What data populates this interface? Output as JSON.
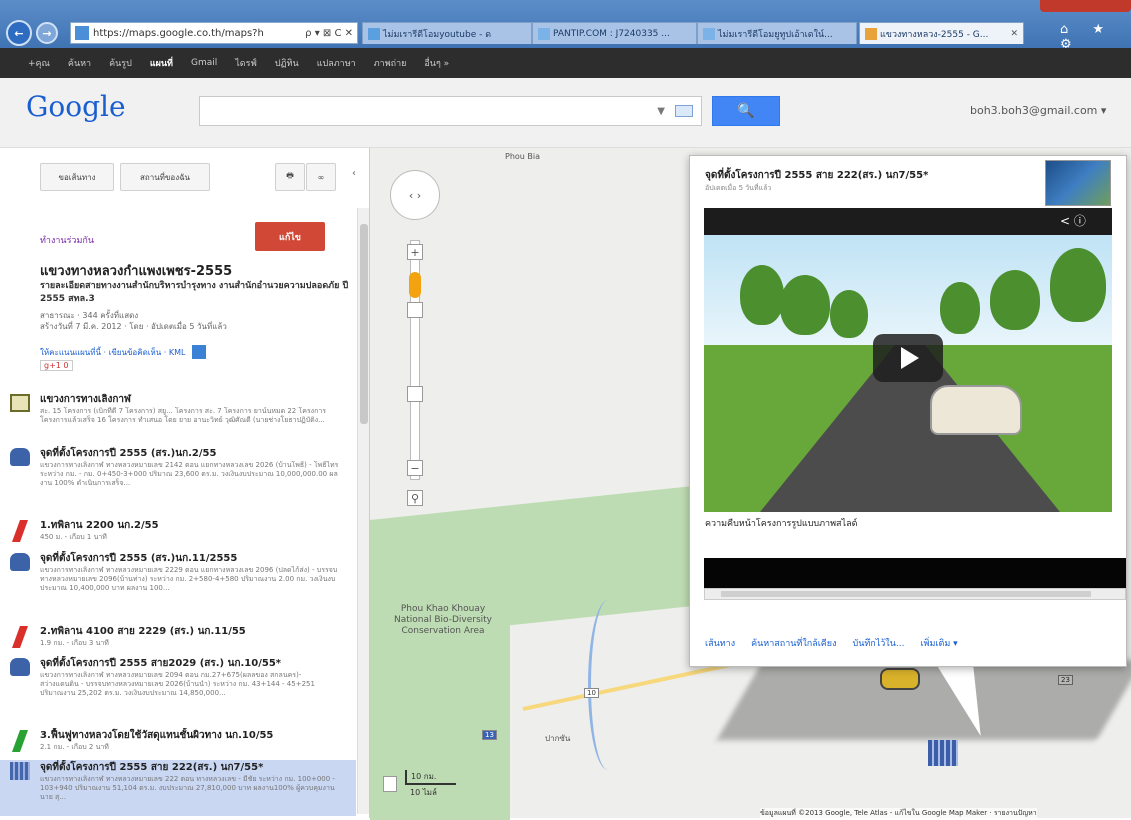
{
  "browser": {
    "address": "https://maps.google.co.th/maps?h",
    "address_controls": "ρ ▾ ⊠ C ✕",
    "tabs": [
      {
        "label": "ไม่มเรารีดีโอมyoutube - ด"
      },
      {
        "label": "PANTIP.COM : J7240335 ..."
      },
      {
        "label": "ไม่มเรารีดีโอมยูทูปเอ้าเดใน์..."
      },
      {
        "label": "แขวงทางหลวง-2555 - G..."
      }
    ],
    "window_icons": "⌂ ★ ⚙"
  },
  "google_bar": {
    "items": [
      "+คุณ",
      "ค้นหา",
      "ค้นรูป",
      "แผนที่",
      "Gmail",
      "ไดรฟ์",
      "ปฏิทิน",
      "แปลภาษา",
      "ภาพถ่าย",
      "อื่นๆ »"
    ],
    "active": "แผนที่"
  },
  "header": {
    "logo": "Google",
    "search_value": "",
    "search_icon": "🔍",
    "user_email": "boh3.boh3@gmail.com ▾"
  },
  "left_panel": {
    "btn_directions": "ขอเส้นทาง",
    "btn_my_places": "สถานที่ของฉัน",
    "print_icon": "🖶",
    "link_icon": "∞",
    "collapse_icon": "‹",
    "collaborate": "ทำงานร่วมกัน",
    "save_button": "แก้ไข",
    "map_title": "แขวงทางหลวงกำแพงเพชร-2555",
    "map_desc": "รายละเอียดสายทางงานสำนักบริหารบำรุงทาง งานสำนักอำนวยความปลอดภัย ปี 2555 สทล.3",
    "map_meta1": "สาธารณะ · 344 ครั้งที่แสดง",
    "map_meta2": "สร้างวันที่ 7 มี.ค. 2012 · โดย · อัปเดตเมื่อ 5 วันที่แล้ว",
    "map_links": "ให้คะแนนแผนที่นี้ · เขียนข้อคิดเห็น · KML",
    "gplus": "g+1 0",
    "items": [
      {
        "icon": "house",
        "title": "แขวงการทางเลิงกาฬ",
        "desc": "สะ. 15 โครงการ (เบิกที่ดี 7 โครงการ) สยู... โครงการ สะ. 7 โครงการ ยาน์นหมด 22 โครงการ โครงการแล้วเสร็จ 16 โครงการ ทำเสนอ โดย ยาย อานะวิทย์ วุฒิศัณดี (นายช่างโยธาปฏิบัติง..."
      },
      {
        "icon": "car",
        "title": "จุดที่ตั้งโครงการปี 2555 (สร.)นก.2/55",
        "desc": "แขวงการทางเลิงกาฬ ทางหลวงหมายเลข 2142 ตอน แยกทางหลวงเลข 2026 (บ้านโพธิ์) - โพธิ์ไทร ระหว่าง กม. - กม. 0+450-3+000 ปริมาณ 23,600 ตร.ม. วงเงินงบประมาณ 10,000,000.00 ผลงาน 100% ดำเนินการเสร็จ..."
      },
      {
        "icon": "red",
        "title": "1.ทพิลาน 2200 นก.2/55",
        "desc": "450 ม. - เกือบ 1 นาที"
      },
      {
        "icon": "car",
        "title": "จุดที่ตั้งโครงการปี 2555 (สร.)นก.11/2555",
        "desc": "แขวงการทางเลิงกาฬ ทางหลวงหมายเลข 2229 ตอน แยกทางหลวงเลข 2096 (ปลดไก้ส่ง) - บรรจบทางหลวงหมายเลข 2096(บ้านท่าง) ระหว่าง กม. 2+580-4+580 ปริมาณงาน 2.00 กม. วงเงินงบประมาณ 10,400,000 บาท ผลงาน 100..."
      },
      {
        "icon": "red",
        "title": "2.ทพิลาน 4100 สาย 2229 (สร.) นก.11/55",
        "desc": "1.9 กม. - เกือบ 3 นาที"
      },
      {
        "icon": "car",
        "title": "จุดที่ตั้งโครงการปี 2555 สาย2029 (สร.) นก.10/55*",
        "desc": "แขวงการทางเลิงกาฬ ทางหลวงหมายเลข 2094 ตอน กม.27+675(ผลลของ สกลนคร)-สว่างแดนดิน - บรรจบทางหลวงหมายเลข 2026(บ้านนำ) ระหว่าง กม. 43+144 - 45+251 ปริมาณงาน 25,202 ตร.ม. วงเงินงบประมาณ 14,850,000..."
      },
      {
        "icon": "green",
        "title": "3.ฟื้นฟูทางหลวงโดยใช้วัสดุแทนชั้นผิวทาง นก.10/55",
        "desc": "2.1 กม. - เกือบ 2 นาที"
      },
      {
        "icon": "pins",
        "title": "จุดที่ตั้งโครงการปี 2555 สาย 222(สร.) นก7/55*",
        "desc": "แขวงการทางเลิงกาฬ ทางหลวงหมายเลข 222 ตอน ทางหลวงเลข - มีชัย ระหว่าง กม. 100+000 - 103+940 ปริมาณงาน 51,104 ตร.ม. งบประมาณ 27,810,000 บาท ผลงาน100% ผู้ควบคุมงาน นาย สุ..."
      }
    ]
  },
  "map": {
    "park_label": "Phou Khao Khouay National Bio-Diversity Conservation Area",
    "phou_bia": "Phou Bia",
    "route_13": "13",
    "shield_10": "10",
    "shield_23": "23",
    "town_label": "ปากซัน",
    "scale_km": "10 กม.",
    "scale_mi": "10 ไมล์",
    "copyright": "ข้อมูลแผนที่ ©2013 Google, Tele Atlas - แก้ไขใน Google Map Maker · รายงานปัญหา",
    "pan_icon": "‹ ›",
    "zoom_in": "+",
    "zoom_out": "−"
  },
  "info_window": {
    "title": "จุดที่ตั้งโครงการปี 2555 สาย 222(สร.) นก7/55*",
    "subtitle": "อัปเดตเมื่อ 5 วันที่แล้ว",
    "video_tools": "< ⓘ",
    "caption": "ความคืบหน้าโครงการรูปแบบภาพสไลด์",
    "links": [
      "เส้นทาง",
      "ค้นหาสถานที่ใกล้เคียง",
      "บันทึกไว้ใน...",
      "เพิ่มเติม ▾"
    ]
  }
}
